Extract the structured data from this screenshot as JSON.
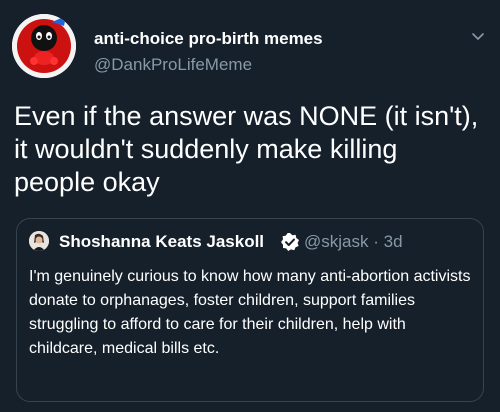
{
  "tweet": {
    "display_name": "anti-choice pro-birth memes",
    "handle": "@DankProLifeMeme",
    "text": "Even if the answer was NONE (it isn't), it wouldn't suddenly make killing people okay"
  },
  "quoted_tweet": {
    "display_name": "Shoshanna Keats Jaskoll",
    "handle": "@skjask",
    "separator": "·",
    "time": "3d",
    "text": "I'm genuinely curious to know how many anti-abortion activists donate to orphanages, foster children, support families struggling to afford to care for their children,  help with childcare, medical bills etc."
  },
  "colors": {
    "background": "#15202b",
    "secondary_text": "#8899a6",
    "border": "#38444d",
    "verified": "#ffffff"
  },
  "icons": {
    "menu": "chevron-down-icon",
    "verified": "verified-badge-icon"
  }
}
